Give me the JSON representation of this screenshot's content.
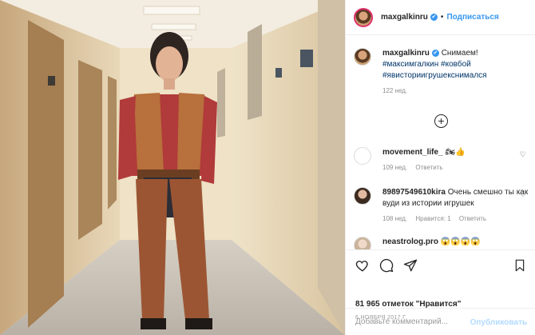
{
  "header": {
    "username": "maxgalkinru",
    "verified": "✔",
    "dot": "•",
    "follow_label": "Подписаться"
  },
  "caption": {
    "username": "maxgalkinru",
    "text": "Снимаем!",
    "tags": [
      "#максимгалкин",
      "#ковбой",
      "#явисториигрушекснимался"
    ],
    "time": "122 нед."
  },
  "load_more": "+",
  "comments": [
    {
      "username": "movement_life_",
      "text": "🏍👍",
      "time": "109 нед.",
      "reply": "Ответить",
      "likes": ""
    },
    {
      "username": "89897549610kira",
      "text": "Очень смешно ты как вуди из истории игрушек",
      "time": "108 нед.",
      "likes": "Нравится: 1",
      "reply": "Ответить"
    },
    {
      "username": "neastrolog.pro",
      "text": "😱😱😱😱",
      "time": "",
      "reply": "",
      "likes": ""
    }
  ],
  "actions": {
    "like_icon": "heart-icon",
    "comment_icon": "comment-icon",
    "share_icon": "share-icon",
    "save_icon": "bookmark-icon"
  },
  "likes_text": "81 965 отметок \"Нравится\"",
  "date": "6 НОЯБРЯ 2017 Г.",
  "comment_input": {
    "placeholder": "Добавьте комментарий...",
    "publish": "Опубликовать"
  },
  "colors": {
    "accent": "#3897f0",
    "text": "#262626",
    "muted": "#8e8e8e"
  }
}
